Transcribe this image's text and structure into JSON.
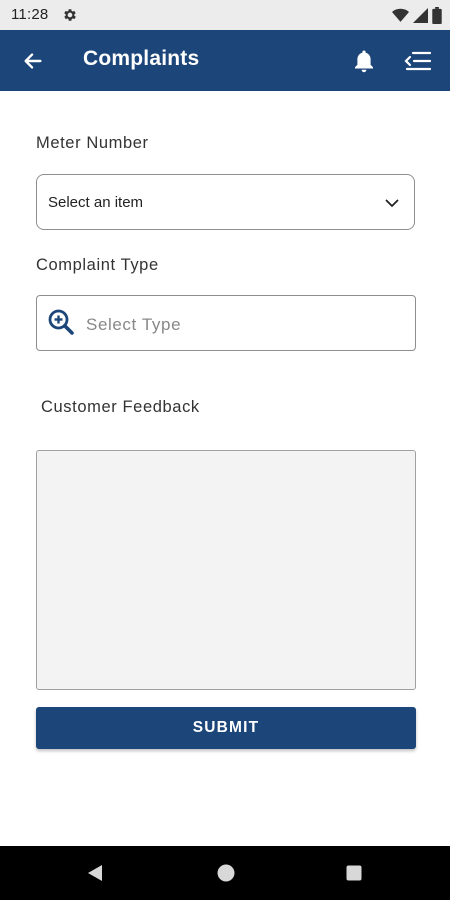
{
  "status_bar": {
    "time": "11:28",
    "icons": [
      "gear-icon",
      "wifi-icon",
      "signal-icon",
      "battery-icon"
    ]
  },
  "app_bar": {
    "title": "Complaints",
    "background_color": "#1c4679",
    "icons": [
      "back-arrow-icon",
      "bell-icon",
      "menu-icon"
    ]
  },
  "form": {
    "meter_number": {
      "label": "Meter Number",
      "selected_value": "Select an item"
    },
    "complaint_type": {
      "label": "Complaint Type",
      "placeholder": "Select Type",
      "value": ""
    },
    "customer_feedback": {
      "label": "Customer Feedback",
      "value": ""
    },
    "submit_label": "SUBMIT"
  },
  "nav_bar": {
    "icons": [
      "nav-back-icon",
      "nav-home-icon",
      "nav-recents-icon"
    ]
  }
}
